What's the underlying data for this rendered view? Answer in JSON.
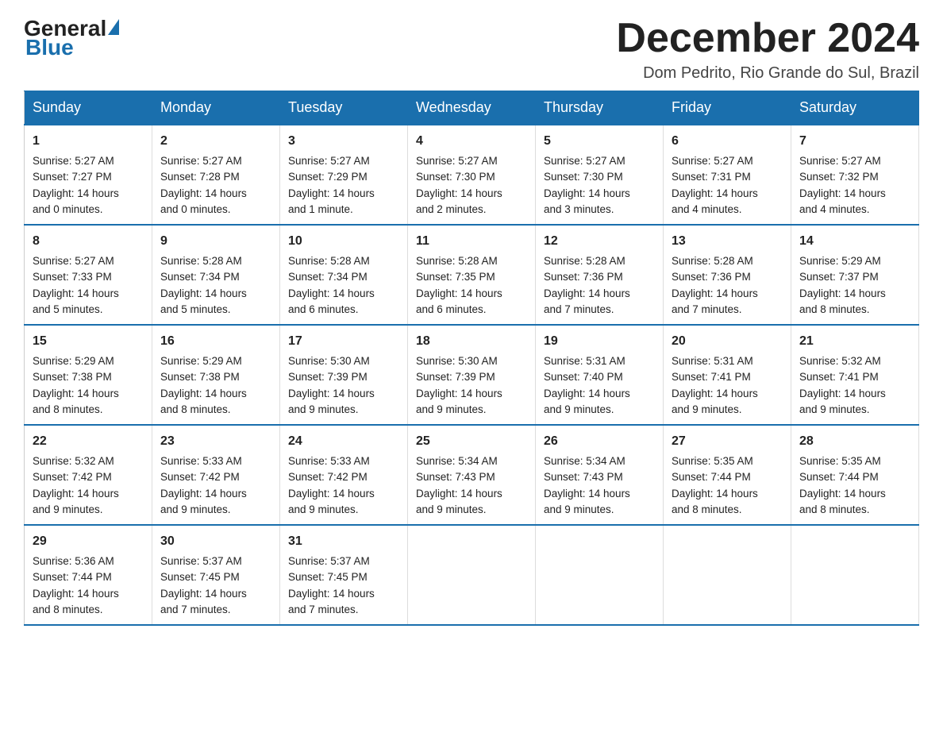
{
  "header": {
    "logo": {
      "general": "General",
      "blue": "Blue"
    },
    "title": "December 2024",
    "location": "Dom Pedrito, Rio Grande do Sul, Brazil"
  },
  "weekdays": [
    "Sunday",
    "Monday",
    "Tuesday",
    "Wednesday",
    "Thursday",
    "Friday",
    "Saturday"
  ],
  "weeks": [
    [
      {
        "day": "1",
        "sunrise": "5:27 AM",
        "sunset": "7:27 PM",
        "daylight_hours": "14",
        "daylight_minutes": "0"
      },
      {
        "day": "2",
        "sunrise": "5:27 AM",
        "sunset": "7:28 PM",
        "daylight_hours": "14",
        "daylight_minutes": "0"
      },
      {
        "day": "3",
        "sunrise": "5:27 AM",
        "sunset": "7:29 PM",
        "daylight_hours": "14",
        "daylight_minutes": "1"
      },
      {
        "day": "4",
        "sunrise": "5:27 AM",
        "sunset": "7:30 PM",
        "daylight_hours": "14",
        "daylight_minutes": "2"
      },
      {
        "day": "5",
        "sunrise": "5:27 AM",
        "sunset": "7:30 PM",
        "daylight_hours": "14",
        "daylight_minutes": "3"
      },
      {
        "day": "6",
        "sunrise": "5:27 AM",
        "sunset": "7:31 PM",
        "daylight_hours": "14",
        "daylight_minutes": "4"
      },
      {
        "day": "7",
        "sunrise": "5:27 AM",
        "sunset": "7:32 PM",
        "daylight_hours": "14",
        "daylight_minutes": "4"
      }
    ],
    [
      {
        "day": "8",
        "sunrise": "5:27 AM",
        "sunset": "7:33 PM",
        "daylight_hours": "14",
        "daylight_minutes": "5"
      },
      {
        "day": "9",
        "sunrise": "5:28 AM",
        "sunset": "7:34 PM",
        "daylight_hours": "14",
        "daylight_minutes": "5"
      },
      {
        "day": "10",
        "sunrise": "5:28 AM",
        "sunset": "7:34 PM",
        "daylight_hours": "14",
        "daylight_minutes": "6"
      },
      {
        "day": "11",
        "sunrise": "5:28 AM",
        "sunset": "7:35 PM",
        "daylight_hours": "14",
        "daylight_minutes": "6"
      },
      {
        "day": "12",
        "sunrise": "5:28 AM",
        "sunset": "7:36 PM",
        "daylight_hours": "14",
        "daylight_minutes": "7"
      },
      {
        "day": "13",
        "sunrise": "5:28 AM",
        "sunset": "7:36 PM",
        "daylight_hours": "14",
        "daylight_minutes": "7"
      },
      {
        "day": "14",
        "sunrise": "5:29 AM",
        "sunset": "7:37 PM",
        "daylight_hours": "14",
        "daylight_minutes": "8"
      }
    ],
    [
      {
        "day": "15",
        "sunrise": "5:29 AM",
        "sunset": "7:38 PM",
        "daylight_hours": "14",
        "daylight_minutes": "8"
      },
      {
        "day": "16",
        "sunrise": "5:29 AM",
        "sunset": "7:38 PM",
        "daylight_hours": "14",
        "daylight_minutes": "8"
      },
      {
        "day": "17",
        "sunrise": "5:30 AM",
        "sunset": "7:39 PM",
        "daylight_hours": "14",
        "daylight_minutes": "9"
      },
      {
        "day": "18",
        "sunrise": "5:30 AM",
        "sunset": "7:39 PM",
        "daylight_hours": "14",
        "daylight_minutes": "9"
      },
      {
        "day": "19",
        "sunrise": "5:31 AM",
        "sunset": "7:40 PM",
        "daylight_hours": "14",
        "daylight_minutes": "9"
      },
      {
        "day": "20",
        "sunrise": "5:31 AM",
        "sunset": "7:41 PM",
        "daylight_hours": "14",
        "daylight_minutes": "9"
      },
      {
        "day": "21",
        "sunrise": "5:32 AM",
        "sunset": "7:41 PM",
        "daylight_hours": "14",
        "daylight_minutes": "9"
      }
    ],
    [
      {
        "day": "22",
        "sunrise": "5:32 AM",
        "sunset": "7:42 PM",
        "daylight_hours": "14",
        "daylight_minutes": "9"
      },
      {
        "day": "23",
        "sunrise": "5:33 AM",
        "sunset": "7:42 PM",
        "daylight_hours": "14",
        "daylight_minutes": "9"
      },
      {
        "day": "24",
        "sunrise": "5:33 AM",
        "sunset": "7:42 PM",
        "daylight_hours": "14",
        "daylight_minutes": "9"
      },
      {
        "day": "25",
        "sunrise": "5:34 AM",
        "sunset": "7:43 PM",
        "daylight_hours": "14",
        "daylight_minutes": "9"
      },
      {
        "day": "26",
        "sunrise": "5:34 AM",
        "sunset": "7:43 PM",
        "daylight_hours": "14",
        "daylight_minutes": "9"
      },
      {
        "day": "27",
        "sunrise": "5:35 AM",
        "sunset": "7:44 PM",
        "daylight_hours": "14",
        "daylight_minutes": "8"
      },
      {
        "day": "28",
        "sunrise": "5:35 AM",
        "sunset": "7:44 PM",
        "daylight_hours": "14",
        "daylight_minutes": "8"
      }
    ],
    [
      {
        "day": "29",
        "sunrise": "5:36 AM",
        "sunset": "7:44 PM",
        "daylight_hours": "14",
        "daylight_minutes": "8"
      },
      {
        "day": "30",
        "sunrise": "5:37 AM",
        "sunset": "7:45 PM",
        "daylight_hours": "14",
        "daylight_minutes": "7"
      },
      {
        "day": "31",
        "sunrise": "5:37 AM",
        "sunset": "7:45 PM",
        "daylight_hours": "14",
        "daylight_minutes": "7"
      },
      null,
      null,
      null,
      null
    ]
  ]
}
